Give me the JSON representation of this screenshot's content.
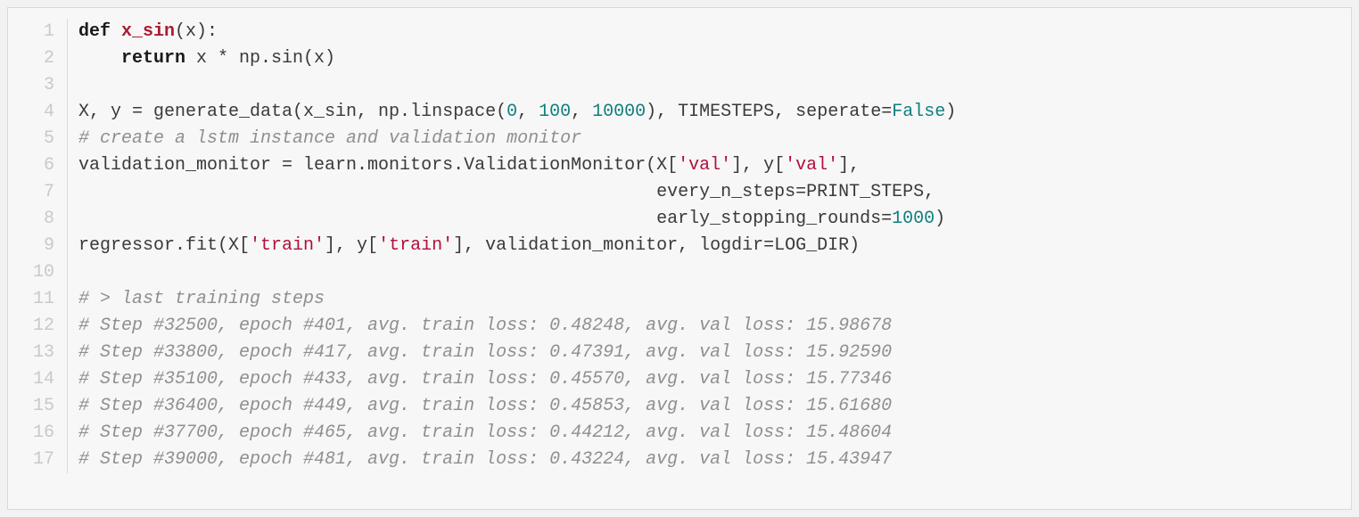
{
  "lines": [
    {
      "n": "1",
      "tokens": [
        {
          "t": "def ",
          "cls": "tok-kw"
        },
        {
          "t": "x_sin",
          "cls": "tok-def"
        },
        {
          "t": "(x):",
          "cls": ""
        }
      ]
    },
    {
      "n": "2",
      "tokens": [
        {
          "t": "    ",
          "cls": ""
        },
        {
          "t": "return",
          "cls": "tok-kw"
        },
        {
          "t": " x * np.sin(x)",
          "cls": ""
        }
      ]
    },
    {
      "n": "3",
      "tokens": [
        {
          "t": "",
          "cls": ""
        }
      ]
    },
    {
      "n": "4",
      "tokens": [
        {
          "t": "X, y = generate_data(x_sin, np.linspace(",
          "cls": ""
        },
        {
          "t": "0",
          "cls": "tok-num"
        },
        {
          "t": ", ",
          "cls": ""
        },
        {
          "t": "100",
          "cls": "tok-num"
        },
        {
          "t": ", ",
          "cls": ""
        },
        {
          "t": "10000",
          "cls": "tok-num"
        },
        {
          "t": "), TIMESTEPS, seperate=",
          "cls": ""
        },
        {
          "t": "False",
          "cls": "tok-builtin"
        },
        {
          "t": ")",
          "cls": ""
        }
      ]
    },
    {
      "n": "5",
      "tokens": [
        {
          "t": "# create a lstm instance and validation monitor",
          "cls": "tok-com"
        }
      ]
    },
    {
      "n": "6",
      "tokens": [
        {
          "t": "validation_monitor = learn.monitors.ValidationMonitor(X[",
          "cls": ""
        },
        {
          "t": "'val'",
          "cls": "tok-str"
        },
        {
          "t": "], y[",
          "cls": ""
        },
        {
          "t": "'val'",
          "cls": "tok-str"
        },
        {
          "t": "],",
          "cls": ""
        }
      ]
    },
    {
      "n": "7",
      "tokens": [
        {
          "t": "                                                      every_n_steps=PRINT_STEPS,",
          "cls": ""
        }
      ]
    },
    {
      "n": "8",
      "tokens": [
        {
          "t": "                                                      early_stopping_rounds=",
          "cls": ""
        },
        {
          "t": "1000",
          "cls": "tok-num"
        },
        {
          "t": ")",
          "cls": ""
        }
      ]
    },
    {
      "n": "9",
      "tokens": [
        {
          "t": "regressor.fit(X[",
          "cls": ""
        },
        {
          "t": "'train'",
          "cls": "tok-str"
        },
        {
          "t": "], y[",
          "cls": ""
        },
        {
          "t": "'train'",
          "cls": "tok-str"
        },
        {
          "t": "], validation_monitor, logdir=LOG_DIR)",
          "cls": ""
        }
      ]
    },
    {
      "n": "10",
      "tokens": [
        {
          "t": "",
          "cls": ""
        }
      ]
    },
    {
      "n": "11",
      "tokens": [
        {
          "t": "# > last training steps",
          "cls": "tok-com"
        }
      ]
    },
    {
      "n": "12",
      "tokens": [
        {
          "t": "# Step #32500, epoch #401, avg. train loss: 0.48248, avg. val loss: 15.98678",
          "cls": "tok-com"
        }
      ]
    },
    {
      "n": "13",
      "tokens": [
        {
          "t": "# Step #33800, epoch #417, avg. train loss: 0.47391, avg. val loss: 15.92590",
          "cls": "tok-com"
        }
      ]
    },
    {
      "n": "14",
      "tokens": [
        {
          "t": "# Step #35100, epoch #433, avg. train loss: 0.45570, avg. val loss: 15.77346",
          "cls": "tok-com"
        }
      ]
    },
    {
      "n": "15",
      "tokens": [
        {
          "t": "# Step #36400, epoch #449, avg. train loss: 0.45853, avg. val loss: 15.61680",
          "cls": "tok-com"
        }
      ]
    },
    {
      "n": "16",
      "tokens": [
        {
          "t": "# Step #37700, epoch #465, avg. train loss: 0.44212, avg. val loss: 15.48604",
          "cls": "tok-com"
        }
      ]
    },
    {
      "n": "17",
      "tokens": [
        {
          "t": "# Step #39000, epoch #481, avg. train loss: 0.43224, avg. val loss: 15.43947",
          "cls": "tok-com"
        }
      ]
    }
  ]
}
